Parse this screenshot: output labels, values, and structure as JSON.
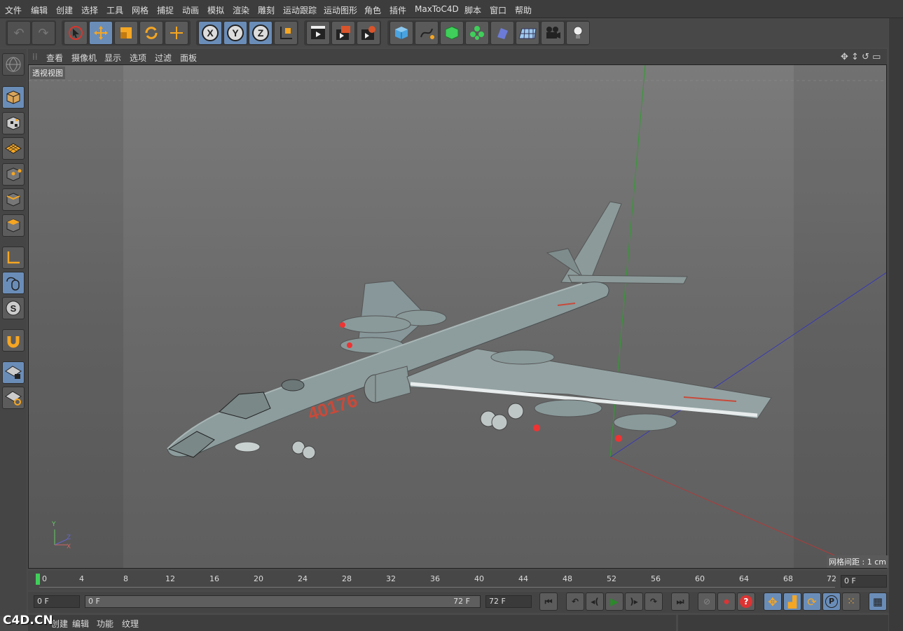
{
  "menu": [
    "文件",
    "编辑",
    "创建",
    "选择",
    "工具",
    "网格",
    "捕捉",
    "动画",
    "模拟",
    "渲染",
    "雕刻",
    "运动跟踪",
    "运动图形",
    "角色",
    "插件",
    "MaxToC4D",
    "脚本",
    "窗口",
    "帮助"
  ],
  "viewport_menu": [
    "查看",
    "摄像机",
    "显示",
    "选项",
    "过滤",
    "面板"
  ],
  "viewport": {
    "title": "透视视图",
    "grid_spacing": "网格间距 : 1 cm",
    "aircraft_number": "40176"
  },
  "axes": {
    "y": "Y",
    "z": "Z",
    "x": "X"
  },
  "timeline": {
    "ticks": [
      "0",
      "4",
      "8",
      "12",
      "16",
      "20",
      "24",
      "28",
      "32",
      "36",
      "40",
      "44",
      "48",
      "52",
      "56",
      "60",
      "64",
      "68",
      "72"
    ],
    "current_frame": "0 F"
  },
  "bottom": {
    "start": "0 F",
    "range_start": "0 F",
    "range_end": "72 F",
    "end": "72 F"
  },
  "material_menu": [
    "创建",
    "编辑",
    "功能",
    "纹理"
  ],
  "logo": "C4D.CN",
  "colors": {
    "accent": "#6a8db8",
    "orange": "#f5a623",
    "y_axis": "#2f9e2f",
    "x_axis": "#b23a3a",
    "z_axis": "#3a3ab2"
  }
}
